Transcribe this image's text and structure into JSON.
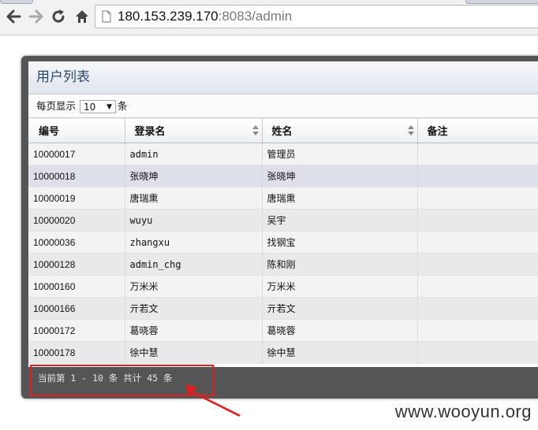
{
  "browser": {
    "url_host": "180.153.239.170",
    "url_rest": ":8083/admin"
  },
  "panel": {
    "title": "用户列表",
    "page_size_label": "每页显示",
    "page_size_value": "10",
    "page_size_suffix": "条"
  },
  "table": {
    "columns": [
      "编号",
      "登录名",
      "姓名",
      "备注"
    ],
    "rows": [
      {
        "id": "10000017",
        "login": "admin",
        "name": "管理员",
        "note": ""
      },
      {
        "id": "10000018",
        "login": "张晓坤",
        "name": "张晓坤",
        "note": ""
      },
      {
        "id": "10000019",
        "login": "唐瑞熏",
        "name": "唐瑞熏",
        "note": ""
      },
      {
        "id": "10000020",
        "login": "wuyu",
        "name": "吴宇",
        "note": ""
      },
      {
        "id": "10000036",
        "login": "zhangxu",
        "name": "找钢宝",
        "note": ""
      },
      {
        "id": "10000128",
        "login": "admin_chg",
        "name": "陈和刚",
        "note": ""
      },
      {
        "id": "10000160",
        "login": "万米米",
        "name": "万米米",
        "note": ""
      },
      {
        "id": "10000166",
        "login": "亓若文",
        "name": "亓若文",
        "note": ""
      },
      {
        "id": "10000172",
        "login": "葛晓蓉",
        "name": "葛晓蓉",
        "note": ""
      },
      {
        "id": "10000178",
        "login": "徐中慧",
        "name": "徐中慧",
        "note": ""
      }
    ]
  },
  "footer": {
    "info": "当前第 1 - 10 条  共计 45 条"
  },
  "watermark": "www.wooyun.org",
  "icons": {
    "back": "back-arrow-icon",
    "forward": "forward-arrow-icon",
    "reload": "reload-icon",
    "home": "home-icon",
    "page": "page-icon",
    "sort": "sort-icon"
  },
  "colors": {
    "annotation": "#e02020",
    "panel_frame": "#555555",
    "title_text": "#2a4a6a"
  }
}
